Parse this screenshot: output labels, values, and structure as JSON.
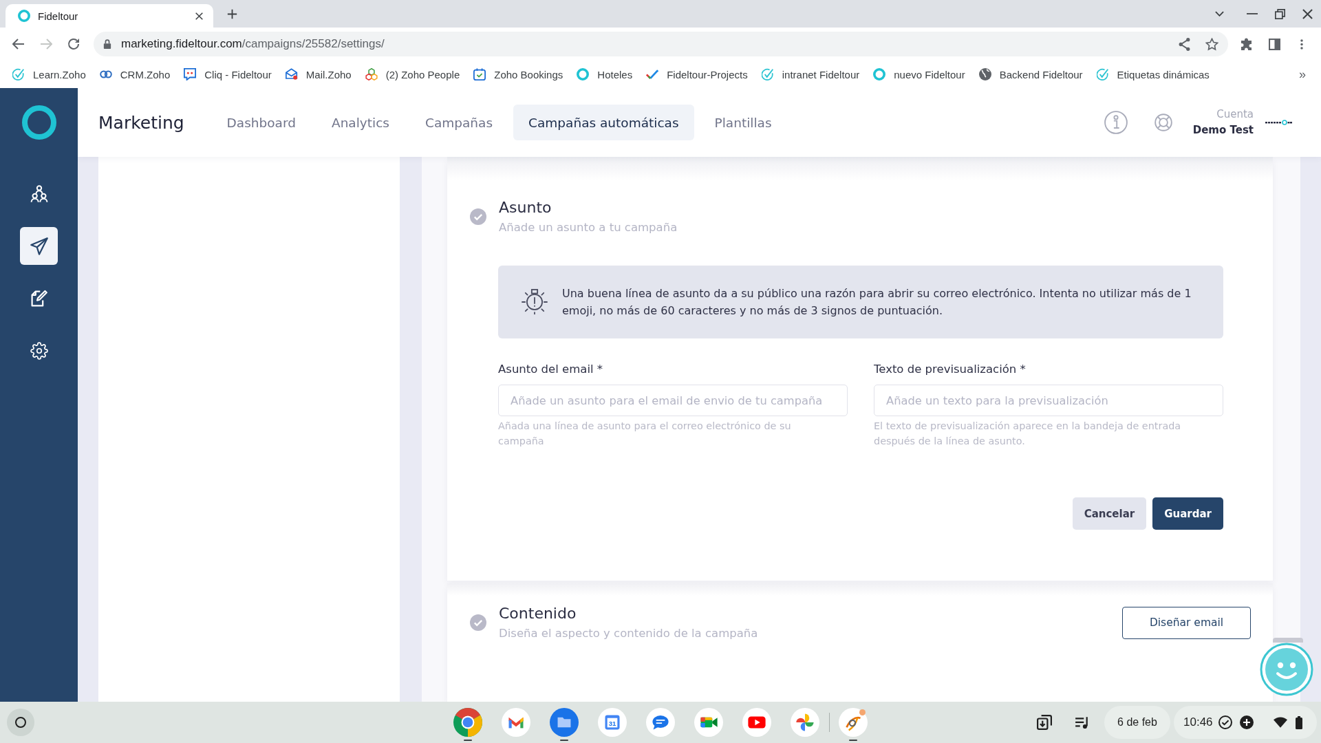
{
  "browser": {
    "tabs": [
      {
        "title": "Fideltour",
        "selected": true
      }
    ],
    "address": {
      "host": "marketing.fideltour.com",
      "path": "/campaigns/25582/settings/"
    },
    "bookmarks": [
      {
        "label": "Learn.Zoho",
        "kind": "check-circle"
      },
      {
        "label": "CRM.Zoho",
        "kind": "link"
      },
      {
        "label": "Cliq - Fideltour",
        "kind": "chat"
      },
      {
        "label": "Mail.Zoho",
        "kind": "mail"
      },
      {
        "label": "(2) Zoho People",
        "kind": "cubes"
      },
      {
        "label": "Zoho Bookings",
        "kind": "calendar-check"
      },
      {
        "label": "Hoteles",
        "kind": "ring"
      },
      {
        "label": "Fideltour-Projects",
        "kind": "tick"
      },
      {
        "label": "intranet Fideltour",
        "kind": "check-circle"
      },
      {
        "label": "nuevo Fideltour",
        "kind": "ring"
      },
      {
        "label": "Backend Fideltour",
        "kind": "globe"
      },
      {
        "label": "Etiquetas dinámicas",
        "kind": "check-circle"
      }
    ],
    "bookmarks_overflow": "»"
  },
  "app": {
    "title": "Marketing",
    "nav": [
      {
        "label": "Dashboard",
        "selected": false
      },
      {
        "label": "Analytics",
        "selected": false
      },
      {
        "label": "Campañas",
        "selected": false
      },
      {
        "label": "Campañas automáticas",
        "selected": true
      },
      {
        "label": "Plantillas",
        "selected": false
      }
    ],
    "account": {
      "label": "Cuenta",
      "name": "Demo Test"
    },
    "sidebar": [
      {
        "kind": "people",
        "selected": false
      },
      {
        "kind": "send",
        "selected": true
      },
      {
        "kind": "edit",
        "selected": false
      },
      {
        "kind": "settings",
        "selected": false
      }
    ]
  },
  "sections": [
    {
      "kind": "form",
      "title": "Asunto",
      "subtitle": "Añade un asunto a tu campaña",
      "tip": "Una buena línea de asunto da a su público una razón para abrir su correo electrónico. Intenta no utilizar más de 1 emoji, no más de 60 caracteres y no más de 3 signos de puntuación.",
      "fields": [
        {
          "label": "Asunto del email *",
          "placeholder": "Añade un asunto para el email de envio de tu campaña",
          "help": "Añada una línea de asunto para el correo electrónico de su campaña"
        },
        {
          "label": "Texto de previsualización *",
          "placeholder": "Añade un texto para la previsualización",
          "help": "El texto de previsualización aparece en la bandeja de entrada después de la línea de asunto."
        }
      ],
      "buttons": [
        {
          "label": "Cancelar",
          "kind": "secondary"
        },
        {
          "label": "Guardar",
          "kind": "primary"
        }
      ]
    },
    {
      "kind": "action",
      "title": "Contenido",
      "subtitle": "Diseña el aspecto y contenido de la campaña",
      "action": "Diseñar email"
    }
  ],
  "shelf": {
    "apps": [
      {
        "kind": "chrome",
        "running": true,
        "badge": false
      },
      {
        "kind": "gmail",
        "running": false,
        "badge": false
      },
      {
        "kind": "files",
        "running": true,
        "badge": false
      },
      {
        "kind": "calendar",
        "text": "31",
        "running": false,
        "badge": false
      },
      {
        "kind": "messages",
        "running": false,
        "badge": false
      },
      {
        "kind": "meet",
        "running": false,
        "badge": false
      },
      {
        "kind": "youtube",
        "running": false,
        "badge": false
      },
      {
        "kind": "photos",
        "running": false,
        "badge": false
      },
      {
        "kind": "swirl",
        "running": true,
        "badge": true
      }
    ],
    "date": "6 de feb",
    "time": "10:46"
  }
}
